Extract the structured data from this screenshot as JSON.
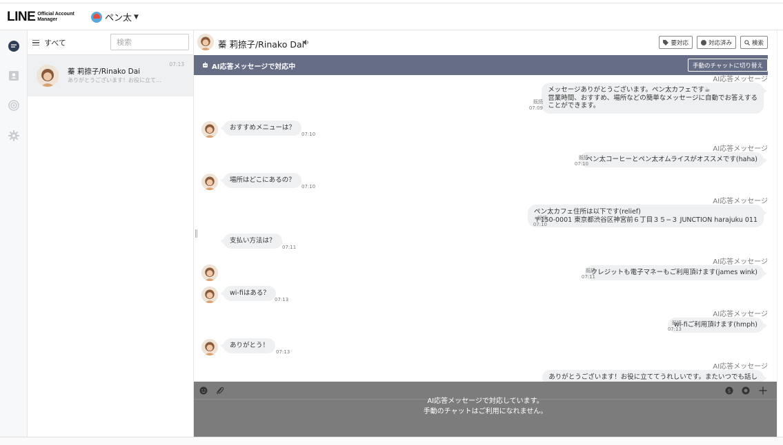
{
  "header": {
    "logo_main": "LINE",
    "logo_sub_1": "Official Account",
    "logo_sub_2": "Manager",
    "account_name": "ペン太"
  },
  "rail": {
    "items": [
      "chat-icon",
      "contacts-icon",
      "broadcast-icon",
      "settings-icon"
    ]
  },
  "chatlist": {
    "filter_label": "すべて",
    "search_placeholder": "検索",
    "conversations": [
      {
        "name": "蓁 莉捺子/Rinako Dai",
        "preview": "ありがとうございます！お役に立て…",
        "time": "07:13"
      }
    ]
  },
  "chat": {
    "contact_name": "蓁 莉捺子/Rinako Dai",
    "buttons": {
      "required": "要対応",
      "done": "対応済み",
      "search": "検索"
    },
    "ai_banner": {
      "text": "AI応答メッセージで対応中",
      "switch_label": "手動のチャットに切り替え"
    },
    "messages": [
      {
        "dir": "out",
        "ai_label": "AI応答メッセージ",
        "lines": [
          "メッセージありがとうございます。ペン太カフェです☕",
          "営業時間、おすすめ、場所などの簡単なメッセージに自動でお答えする",
          "ことができます。"
        ],
        "read": "既読",
        "time": "07:09"
      },
      {
        "dir": "in",
        "text": "おすすめメニューは？",
        "time": "07:10"
      },
      {
        "dir": "out",
        "ai_label": "AI応答メッセージ",
        "lines": [
          "ペン太コーヒーとペン太オムライスがオススメです(haha)"
        ],
        "read": "既読",
        "time": "07:10"
      },
      {
        "dir": "in",
        "text": "場所はどこにあるの？",
        "time": "07:10"
      },
      {
        "dir": "out",
        "ai_label": "AI応答メッセージ",
        "lines": [
          "ペン太カフェ住所は以下です(relief)",
          "〒150-0001 東京都渋谷区神宮前６丁目３５−３ JUNCTION harajuku 011"
        ],
        "read": "既読",
        "time": "07:10"
      },
      {
        "dir": "in",
        "text": "支払い方法は？",
        "time": "07:11"
      },
      {
        "dir": "out",
        "ai_label": "AI応答メッセージ",
        "lines": [
          "クレジットも電子マネーもご利用頂けます(james wink)"
        ],
        "read": "既読",
        "time": "07:11"
      },
      {
        "dir": "in",
        "text": "wi-fiはある？",
        "time": "07:13"
      },
      {
        "dir": "out",
        "ai_label": "AI応答メッセージ",
        "lines": [
          "wi-fiご利用頂けます(hmph)"
        ],
        "read": "既読",
        "time": "07:13"
      },
      {
        "dir": "in",
        "text": "ありがとう！",
        "time": "07:13"
      },
      {
        "dir": "out",
        "ai_label": "AI応答メッセージ",
        "lines": [
          "ありがとうございます！お役に立ててうれしいです。またいつでも話し"
        ],
        "read": "",
        "time": ""
      }
    ],
    "composer": {
      "line1": "AI応答メッセージで対応しています。",
      "line2": "手動のチャットはご利用になれません。"
    }
  },
  "colors": {
    "banner": "#666e86",
    "bubble": "#eef0f2",
    "composer_disabled": "#7c7c7c"
  }
}
